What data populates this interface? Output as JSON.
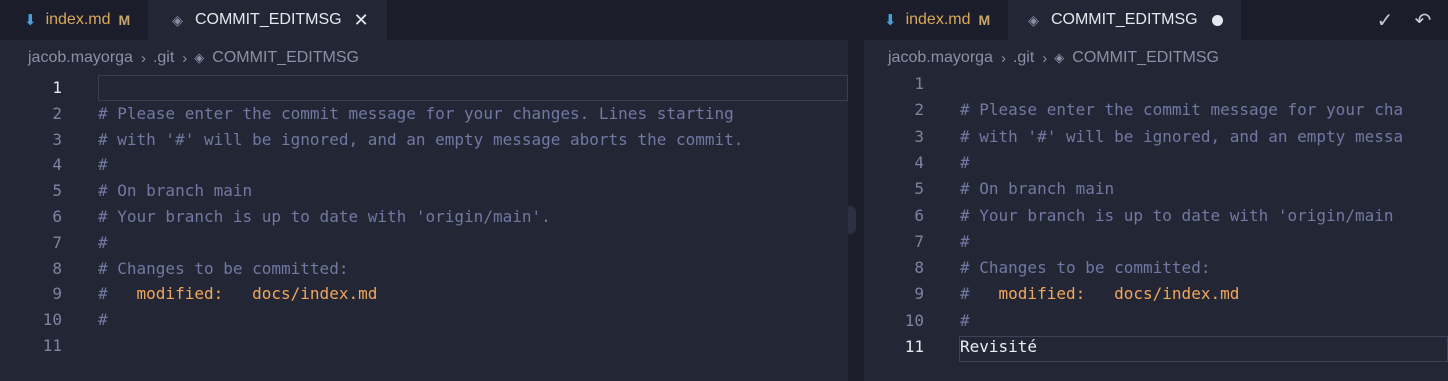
{
  "left": {
    "tabs": [
      {
        "name": "index.md",
        "badge": "M",
        "kind": "markdown",
        "active": false
      },
      {
        "name": "COMMIT_EDITMSG",
        "kind": "git",
        "active": true,
        "close": "✕"
      }
    ],
    "breadcrumb": [
      "jacob.mayorga",
      ".git",
      "COMMIT_EDITMSG"
    ],
    "current_line": 1,
    "lines": [
      {
        "n": "1",
        "text": ""
      },
      {
        "n": "2",
        "text": "# Please enter the commit message for your changes. Lines starting"
      },
      {
        "n": "3",
        "text": "# with '#' will be ignored, and an empty message aborts the commit."
      },
      {
        "n": "4",
        "text": "#"
      },
      {
        "n": "5",
        "text": "# On branch main"
      },
      {
        "n": "6",
        "text": "# Your branch is up to date with 'origin/main'."
      },
      {
        "n": "7",
        "text": "#"
      },
      {
        "n": "8",
        "text": "# Changes to be committed:"
      },
      {
        "n": "9",
        "prefix": "#   ",
        "mod": "modified:   docs/index.md"
      },
      {
        "n": "10",
        "text": "#"
      },
      {
        "n": "11",
        "text": ""
      }
    ]
  },
  "right": {
    "tabs": [
      {
        "name": "index.md",
        "badge": "M",
        "kind": "markdown",
        "active": false
      },
      {
        "name": "COMMIT_EDITMSG",
        "kind": "git",
        "active": true,
        "dirty": true
      }
    ],
    "actions": [
      {
        "name": "commit-check-icon",
        "glyph": "✓"
      },
      {
        "name": "undo-icon",
        "glyph": "↶"
      }
    ],
    "breadcrumb": [
      "jacob.mayorga",
      ".git",
      "COMMIT_EDITMSG"
    ],
    "current_line": 11,
    "lines": [
      {
        "n": "1",
        "text": ""
      },
      {
        "n": "2",
        "text": "# Please enter the commit message for your cha"
      },
      {
        "n": "3",
        "text": "# with '#' will be ignored, and an empty messa"
      },
      {
        "n": "4",
        "text": "#"
      },
      {
        "n": "5",
        "text": "# On branch main"
      },
      {
        "n": "6",
        "text": "# Your branch is up to date with 'origin/main"
      },
      {
        "n": "7",
        "text": "#"
      },
      {
        "n": "8",
        "text": "# Changes to be committed:"
      },
      {
        "n": "9",
        "prefix": "#   ",
        "mod": "modified:   docs/index.md"
      },
      {
        "n": "10",
        "text": "#"
      },
      {
        "n": "11",
        "typed": "Revisité"
      }
    ]
  },
  "colors": {
    "background": "#232735",
    "comment": "#7178a2",
    "modified": "#f2a65a",
    "typed_text": "#eceef4",
    "markdown_icon": "#4aa0d8"
  }
}
